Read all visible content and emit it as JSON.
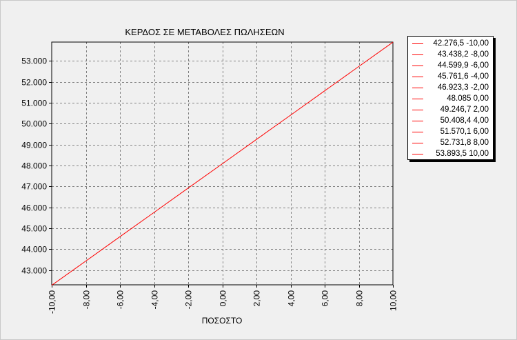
{
  "chart_data": {
    "type": "line",
    "title": "ΚΕΡΔΟΣ ΣΕ ΜΕΤΑΒΟΛΕΣ ΠΩΛΗΣΕΩΝ",
    "xlabel": "ΠΟΣΟΣΤΟ",
    "ylabel": "",
    "xlim": [
      -10,
      10
    ],
    "ylim": [
      42300,
      53900
    ],
    "grid": true,
    "legend_position": "right",
    "x_ticks": [
      "-10,00",
      "-8,00",
      "-6,00",
      "-4,00",
      "-2,00",
      "0,00",
      "2,00",
      "4,00",
      "6,00",
      "8,00",
      "10,00"
    ],
    "x_tick_values": [
      -10,
      -8,
      -6,
      -4,
      -2,
      0,
      2,
      4,
      6,
      8,
      10
    ],
    "y_ticks": [
      "43.000",
      "44.000",
      "45.000",
      "46.000",
      "47.000",
      "48.000",
      "49.000",
      "50.000",
      "51.000",
      "52.000",
      "53.000"
    ],
    "y_tick_values": [
      43000,
      44000,
      45000,
      46000,
      47000,
      48000,
      49000,
      50000,
      51000,
      52000,
      53000
    ],
    "series": [
      {
        "color": "#ff0000",
        "x": [
          -10,
          -8,
          -6,
          -4,
          -2,
          0,
          2,
          4,
          6,
          8,
          10
        ],
        "values": [
          42276.5,
          43438.2,
          44599.9,
          45761.6,
          46923.3,
          48085,
          49246.7,
          50408.4,
          51570.1,
          52731.8,
          53893.5
        ]
      }
    ],
    "legend_entries": [
      "42.276,5 -10,00",
      "43.438,2 -8,00",
      "44.599,9 -6,00",
      "45.761,6 -4,00",
      "46.923,3 -2,00",
      "48.085 0,00",
      "49.246,7 2,00",
      "50.408,4 4,00",
      "51.570,1 6,00",
      "52.731,8 8,00",
      "53.893,5 10,00"
    ]
  }
}
